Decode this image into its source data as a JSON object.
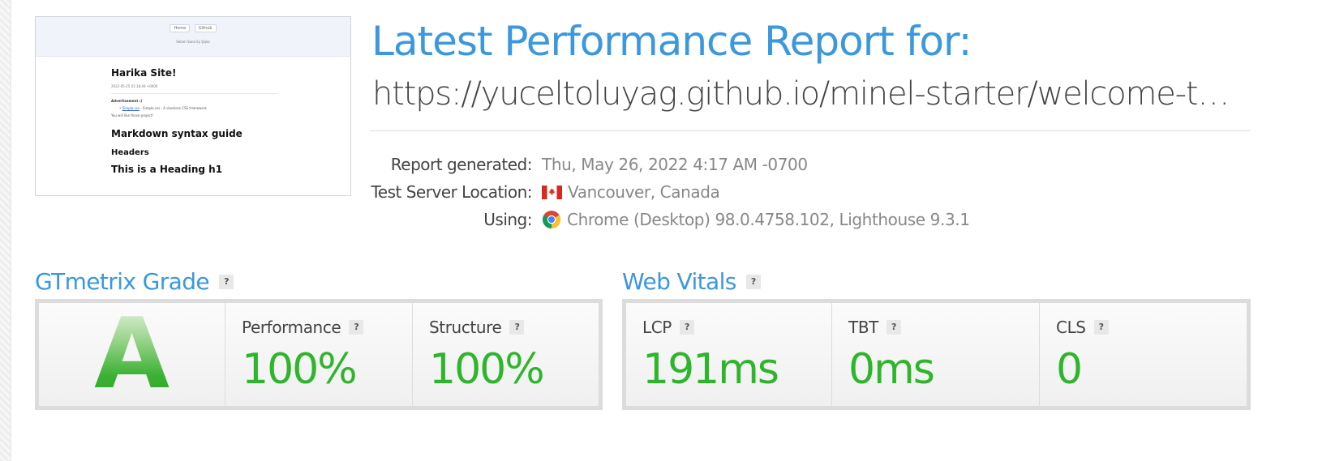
{
  "thumbnail": {
    "nav": [
      "Home",
      "Github"
    ],
    "subtitle": "Selam Sana Ey Şişko",
    "title": "Harika Site!",
    "date": "2022-05-25 01:18:49 +0000",
    "advertisement_label": "Advertisement :)",
    "ad_link": "Simple.css",
    "ad_text": " - Simple.css - A classless CSS framework",
    "note": "You will like those project!",
    "heading2": "Markdown syntax guide",
    "heading3": "Headers",
    "heading4": "This is a Heading h1"
  },
  "header": {
    "title": "Latest Performance Report for:",
    "url": "https://yuceltoluyag.github.io/minel-starter/welcome-to-jekyll/"
  },
  "meta": {
    "generated_label": "Report generated:",
    "generated_value": "Thu, May 26, 2022 4:17 AM -0700",
    "location_label": "Test Server Location:",
    "location_value": "Vancouver, Canada",
    "using_label": "Using:",
    "using_value": "Chrome (Desktop) 98.0.4758.102, Lighthouse 9.3.1"
  },
  "grade": {
    "title": "GTmetrix Grade",
    "help": "?",
    "letter": "A",
    "performance_label": "Performance",
    "performance_value": "100%",
    "structure_label": "Structure",
    "structure_value": "100%"
  },
  "vitals": {
    "title": "Web Vitals",
    "help": "?",
    "lcp_label": "LCP",
    "lcp_value": "191ms",
    "tbt_label": "TBT",
    "tbt_value": "0ms",
    "cls_label": "CLS",
    "cls_value": "0"
  },
  "colors": {
    "accent": "#3b98dd",
    "good": "#2fb52b"
  },
  "icons": {
    "flag": "canada-flag-icon",
    "browser": "chrome-icon"
  }
}
